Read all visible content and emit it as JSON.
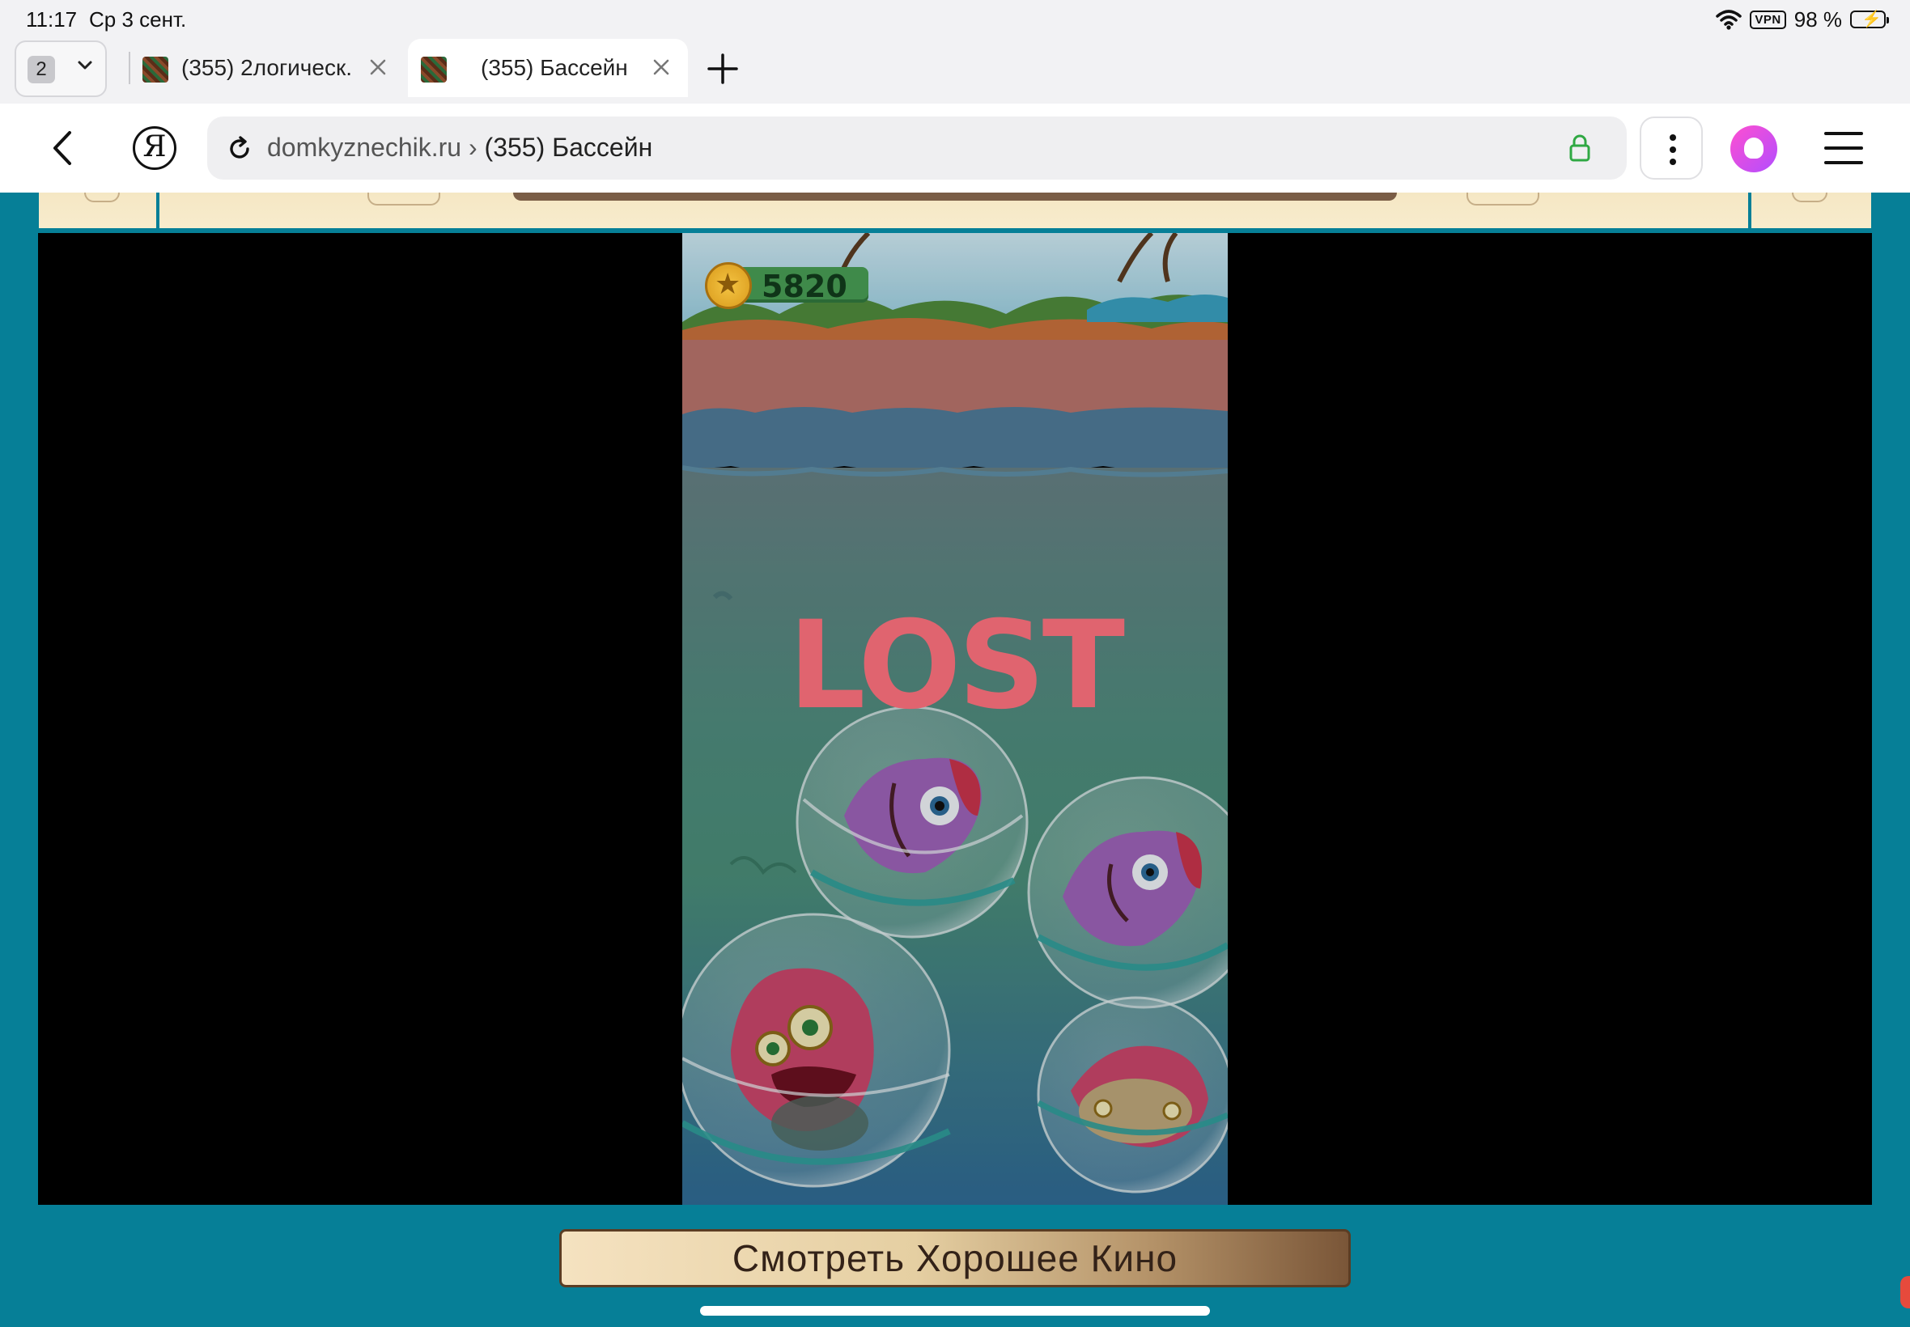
{
  "status_bar": {
    "time": "11:17",
    "date": "Ср 3 сент.",
    "vpn": "VPN",
    "battery": "98 %"
  },
  "tabs": {
    "count": "2",
    "items": [
      {
        "title": "(355) 2логическ...",
        "active": false
      },
      {
        "title": "(355) Бассейн",
        "active": true
      }
    ]
  },
  "address_bar": {
    "domain": "domkyznechik.ru",
    "separator": " › ",
    "page": "(355) Бассейн",
    "yandex_letter": "Я"
  },
  "game": {
    "coins": "5820",
    "result": "LOST"
  },
  "footer": {
    "watch_button": "Смотреть Хорошее Кино"
  },
  "colors": {
    "page_background": "#067f97",
    "lock": "#2fa843",
    "alice_gradient": [
      "#ff4fd0",
      "#b24dff"
    ],
    "lost_text": "#e0646f"
  }
}
